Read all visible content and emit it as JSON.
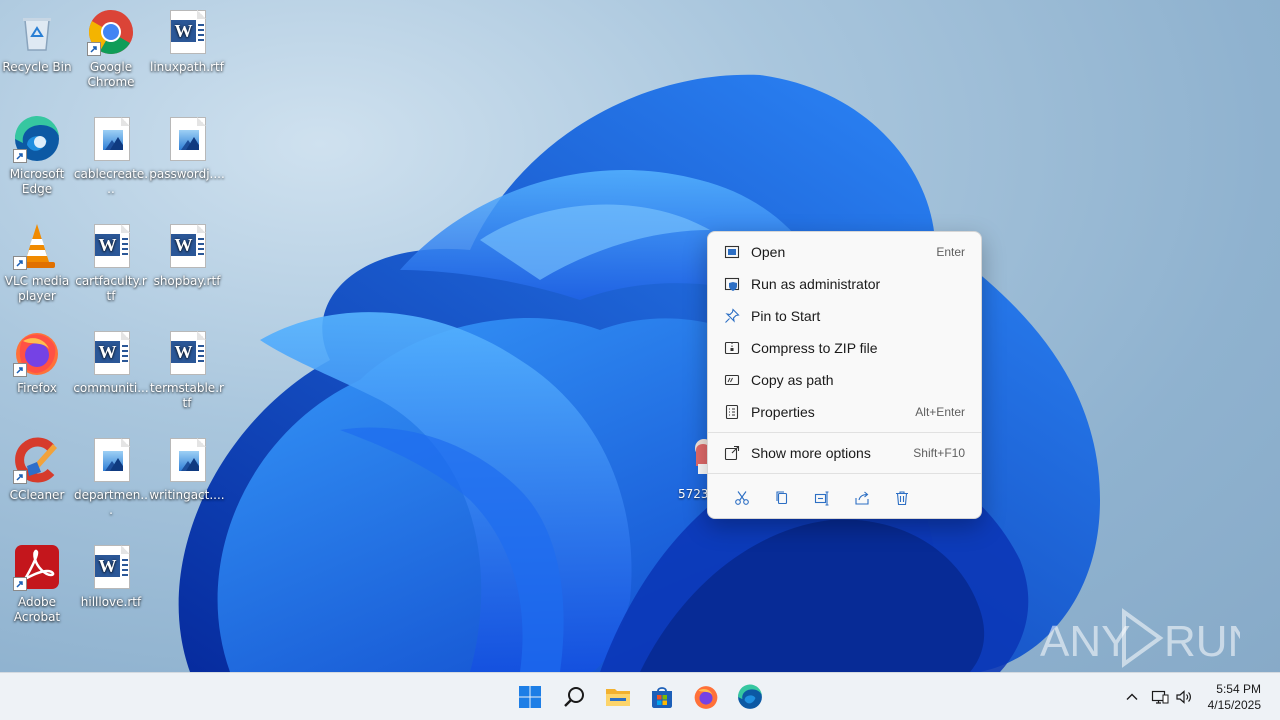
{
  "desktop": {
    "icons": [
      {
        "label": "Recycle Bin",
        "icon": "recycle-bin-icon"
      },
      {
        "label": "Google Chrome",
        "icon": "chrome-icon"
      },
      {
        "label": "linuxpath.rtf",
        "icon": "word-document-icon"
      },
      {
        "label": "Microsoft Edge",
        "icon": "edge-icon"
      },
      {
        "label": "cablecreate...",
        "icon": "image-file-icon"
      },
      {
        "label": "passwordj....",
        "icon": "image-file-icon"
      },
      {
        "label": "VLC media player",
        "icon": "vlc-icon"
      },
      {
        "label": "cartfaculty.rtf",
        "icon": "word-document-icon"
      },
      {
        "label": "shopbay.rtf",
        "icon": "word-document-icon"
      },
      {
        "label": "Firefox",
        "icon": "firefox-icon"
      },
      {
        "label": "communiti...",
        "icon": "word-document-icon"
      },
      {
        "label": "termstable.rtf",
        "icon": "word-document-icon"
      },
      {
        "label": "CCleaner",
        "icon": "ccleaner-icon"
      },
      {
        "label": "departmen...",
        "icon": "image-file-icon"
      },
      {
        "label": "writingact....",
        "icon": "image-file-icon"
      },
      {
        "label": "Adobe Acrobat",
        "icon": "acrobat-icon"
      },
      {
        "label": "hilllove.rtf",
        "icon": "word-document-icon"
      }
    ],
    "partial_icon_label": "57237"
  },
  "context_menu": {
    "items": [
      {
        "label": "Open",
        "shortcut": "Enter",
        "icon": "open-window-icon"
      },
      {
        "label": "Run as administrator",
        "shortcut": "",
        "icon": "shield-window-icon"
      },
      {
        "label": "Pin to Start",
        "shortcut": "",
        "icon": "pin-icon"
      },
      {
        "label": "Compress to ZIP file",
        "shortcut": "",
        "icon": "zip-icon"
      },
      {
        "label": "Copy as path",
        "shortcut": "",
        "icon": "copy-path-icon"
      },
      {
        "label": "Properties",
        "shortcut": "Alt+Enter",
        "icon": "properties-icon"
      }
    ],
    "more": {
      "label": "Show more options",
      "shortcut": "Shift+F10",
      "icon": "more-options-icon"
    },
    "actions": [
      "cut-icon",
      "copy-icon",
      "rename-icon",
      "share-icon",
      "delete-icon"
    ]
  },
  "watermark": {
    "text_left": "ANY",
    "text_right": "RUN"
  },
  "taskbar": {
    "apps": [
      "start-icon",
      "search-icon",
      "file-explorer-icon",
      "store-icon",
      "firefox-icon",
      "edge-icon"
    ],
    "tray": [
      "chevron-up-icon",
      "network-icon",
      "volume-icon"
    ],
    "time": "5:54 PM",
    "date": "4/15/2025"
  },
  "colors": {
    "accent": "#0067c0",
    "taskbar": "#eef2f6",
    "menu": "#f9f9f9"
  }
}
